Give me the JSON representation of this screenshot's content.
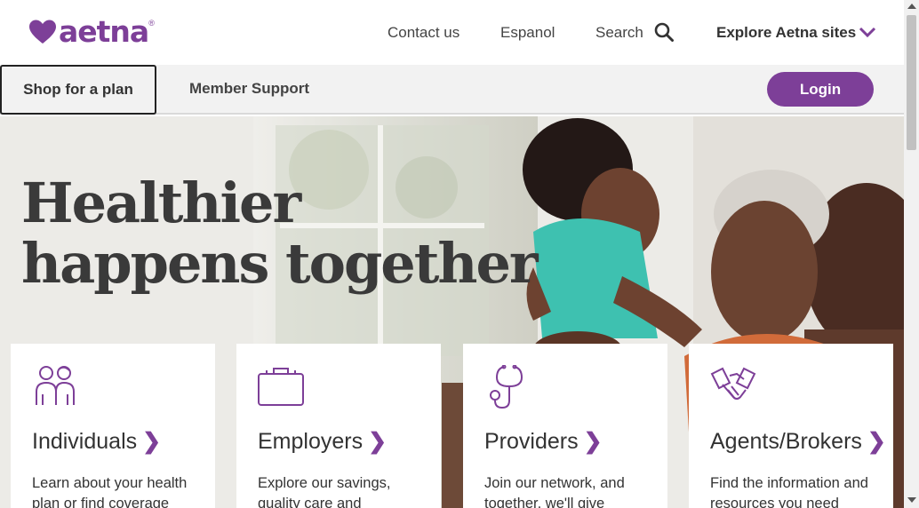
{
  "header": {
    "logo_text": "aetna",
    "logo_mark": "®",
    "contact": "Contact us",
    "espanol": "Espanol",
    "search": "Search",
    "explore": "Explore Aetna sites"
  },
  "nav": {
    "shop": "Shop for a plan",
    "member": "Member Support",
    "login": "Login"
  },
  "hero": {
    "line1": "Healthier",
    "line2": "happens together"
  },
  "cards": [
    {
      "icon": "people-icon",
      "title": "Individuals",
      "desc": "Learn about your health plan or find coverage"
    },
    {
      "icon": "briefcase-icon",
      "title": "Employers",
      "desc": "Explore our savings, quality care and"
    },
    {
      "icon": "stethoscope-icon",
      "title": "Providers",
      "desc": "Join our network, and together, we'll give"
    },
    {
      "icon": "handshake-icon",
      "title": "Agents/Brokers",
      "desc": "Find the information and resources you need"
    }
  ],
  "colors": {
    "brand": "#7d3f98",
    "text": "#333333",
    "nav_bg": "#f2f2f2"
  }
}
